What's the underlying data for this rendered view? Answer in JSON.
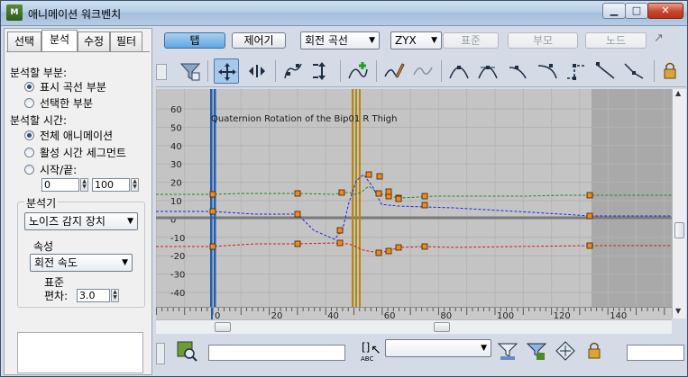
{
  "window": {
    "title": "애니메이션 워크벤치",
    "app_icon_text": "M"
  },
  "left": {
    "tabs": [
      "선택",
      "분석",
      "수정",
      "필터"
    ],
    "analyze_part_label": "분석할 부분:",
    "analyze_part_options": [
      "표시 곡선 부분",
      "선택한 부분"
    ],
    "analyze_time_label": "분석할 시간:",
    "analyze_time_options": [
      "전체 애니메이션",
      "활성 시간 세그먼트",
      "시작/끝:"
    ],
    "start_value": "0",
    "end_value": "100",
    "analyzer_label": "분석기",
    "analyzer_value": "노이즈 감지 장치",
    "property_label": "속성",
    "property_value": "회전 속도",
    "std_dev_label_line1": "표준",
    "std_dev_label_line2": "편차:",
    "std_dev_value": "3.0"
  },
  "toolbar": {
    "tab_button": "탭",
    "controller_button": "제어기",
    "curve_type_value": "회전 곡선",
    "axis_order_value": "ZYX",
    "standard_button": "표준",
    "parent_button": "부모",
    "node_button": "노드"
  },
  "graph": {
    "curve_title": "Quaternion Rotation of the Bip01 R Thigh",
    "y_ticks": [
      "60",
      "50",
      "40",
      "30",
      "20",
      "10",
      "0",
      "-10",
      "-20",
      "-30",
      "-40"
    ],
    "x_ticks": [
      "0",
      "20",
      "40",
      "60",
      "80",
      "100",
      "120",
      "140"
    ]
  },
  "bottom": {
    "abc_label": "ABC"
  },
  "colors": {
    "accent_blue": "#61a6e0",
    "graph_bg": "#c4c4c4",
    "curve_green": "#1f8a1f",
    "curve_blue": "#2222ee",
    "curve_red": "#d01a1a",
    "key_orange": "#f08a1c",
    "time_cursor_gold": "#b8860b",
    "range_blue": "#1e5fb4"
  },
  "icons": [
    "filter-icon",
    "move-keys-icon",
    "slide-keys-icon",
    "scale-keys-icon",
    "scale-values-icon",
    "add-keys-icon",
    "draw-curves-icon",
    "reduce-keys-icon",
    "tangent-auto-icon",
    "tangent-custom-icon",
    "tangent-fast-icon",
    "tangent-slow-icon",
    "tangent-step-icon",
    "tangent-linear-icon",
    "tangent-smooth-icon",
    "lock-icon"
  ]
}
